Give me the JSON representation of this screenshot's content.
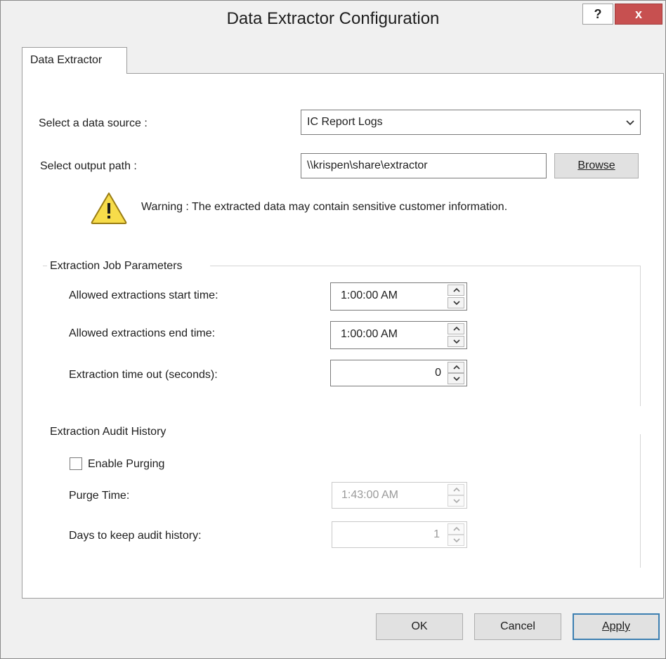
{
  "window": {
    "title": "Data Extractor Configuration",
    "help_label": "?",
    "close_label": "x"
  },
  "tab": {
    "label": "Data Extractor"
  },
  "data_source": {
    "label": "Select a data source :",
    "value": "IC Report Logs"
  },
  "output_path": {
    "label": "Select output path :",
    "value": "\\\\krispen\\share\\extractor",
    "browse_label": "Browse"
  },
  "warning": {
    "text": "Warning : The extracted data may contain sensitive customer information."
  },
  "job_params": {
    "title": "Extraction Job Parameters",
    "start_label": "Allowed extractions start time:",
    "start_value": "1:00:00 AM",
    "end_label": "Allowed extractions end time:",
    "end_value": "1:00:00 AM",
    "timeout_label": "Extraction time out (seconds):",
    "timeout_value": "0"
  },
  "audit": {
    "title": "Extraction Audit History",
    "purge_checkbox_label": "Enable Purging",
    "purge_checked": false,
    "purge_time_label": "Purge Time:",
    "purge_time_value": "1:43:00 AM",
    "days_label": "Days to keep audit history:",
    "days_value": "1"
  },
  "footer": {
    "ok_label": "OK",
    "cancel_label": "Cancel",
    "apply_label": "Apply"
  },
  "icons": {
    "warning": "warning-icon",
    "dropdown": "chevron-down-icon",
    "spin_up": "spin-up-icon",
    "spin_down": "spin-down-icon"
  }
}
